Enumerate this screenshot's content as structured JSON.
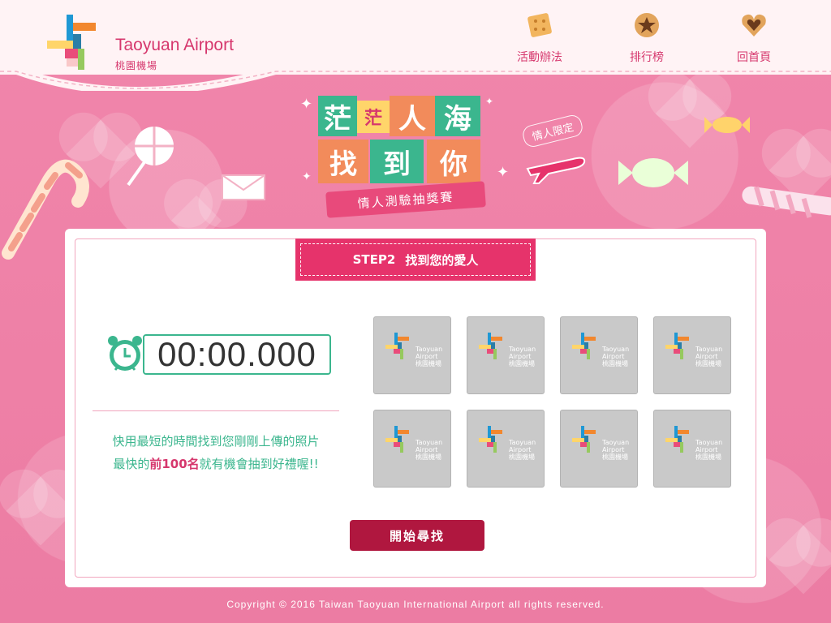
{
  "app": {
    "logo_en": "Taoyuan Airport",
    "logo_zh": "桃園機場"
  },
  "nav": {
    "items": [
      {
        "label": "活動辦法",
        "icon": "cracker-icon"
      },
      {
        "label": "排行榜",
        "icon": "cookie-star-icon"
      },
      {
        "label": "回首頁",
        "icon": "heart-cookie-icon"
      }
    ]
  },
  "hero": {
    "title_row1": [
      "茫",
      "茫",
      "人",
      "海"
    ],
    "title_row2": [
      "找",
      "到",
      "你"
    ],
    "subtitle": "情人測驗抽獎賽",
    "badge": "情人限定"
  },
  "step": {
    "label": "STEP2",
    "title": "找到您的愛人"
  },
  "timer": {
    "value": "00:00.000"
  },
  "description": {
    "line1": "快用最短的時間找到您剛剛上傳的照片",
    "line2_prefix": "最快的",
    "line2_highlight": "前100名",
    "line2_suffix": "就有機會抽到好禮喔!!"
  },
  "tiles": [
    {
      "name": "Taoyuan Airport",
      "zh": "桃園機場"
    },
    {
      "name": "Taoyuan Airport",
      "zh": "桃園機場"
    },
    {
      "name": "Taoyuan Airport",
      "zh": "桃園機場"
    },
    {
      "name": "Taoyuan Airport",
      "zh": "桃園機場"
    },
    {
      "name": "Taoyuan Airport",
      "zh": "桃園機場"
    },
    {
      "name": "Taoyuan Airport",
      "zh": "桃園機場"
    },
    {
      "name": "Taoyuan Airport",
      "zh": "桃園機場"
    },
    {
      "name": "Taoyuan Airport",
      "zh": "桃園機場"
    }
  ],
  "buttons": {
    "start": "開始尋找"
  },
  "footer": {
    "copyright": "Copyright © 2016 Taiwan Taoyuan International Airport all rights reserved."
  },
  "colors": {
    "accent": "#d6376d",
    "green": "#3bb68e",
    "button": "#b0173f"
  }
}
